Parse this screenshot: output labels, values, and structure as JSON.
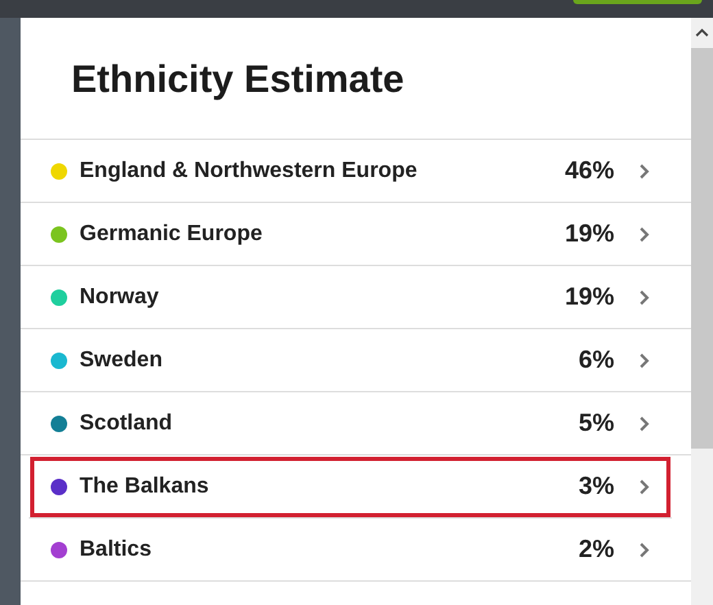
{
  "title": "Ethnicity Estimate",
  "regions": [
    {
      "name": "England & Northwestern Europe",
      "percent": "46%",
      "color": "#efd700",
      "highlighted": false
    },
    {
      "name": "Germanic Europe",
      "percent": "19%",
      "color": "#7bc41f",
      "highlighted": false
    },
    {
      "name": "Norway",
      "percent": "19%",
      "color": "#1fcf9e",
      "highlighted": false
    },
    {
      "name": "Sweden",
      "percent": "6%",
      "color": "#1ab8d0",
      "highlighted": false
    },
    {
      "name": "Scotland",
      "percent": "5%",
      "color": "#137f96",
      "highlighted": false
    },
    {
      "name": "The Balkans",
      "percent": "3%",
      "color": "#5a2fc8",
      "highlighted": true
    },
    {
      "name": "Baltics",
      "percent": "2%",
      "color": "#a33fd1",
      "highlighted": false
    }
  ]
}
